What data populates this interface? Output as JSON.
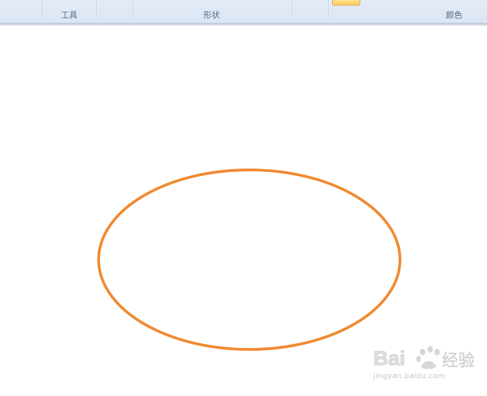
{
  "ribbon": {
    "groups": [
      {
        "label": "工具"
      },
      {
        "label": "形状"
      },
      {
        "label": "颜色"
      }
    ],
    "selected_color": "#ffd37a"
  },
  "canvas": {
    "shape": "ellipse",
    "stroke_color": "#f08a30",
    "fill": "none"
  },
  "watermark": {
    "logo_text": "Bai 经验",
    "url": "jingyan.baidu.com"
  }
}
